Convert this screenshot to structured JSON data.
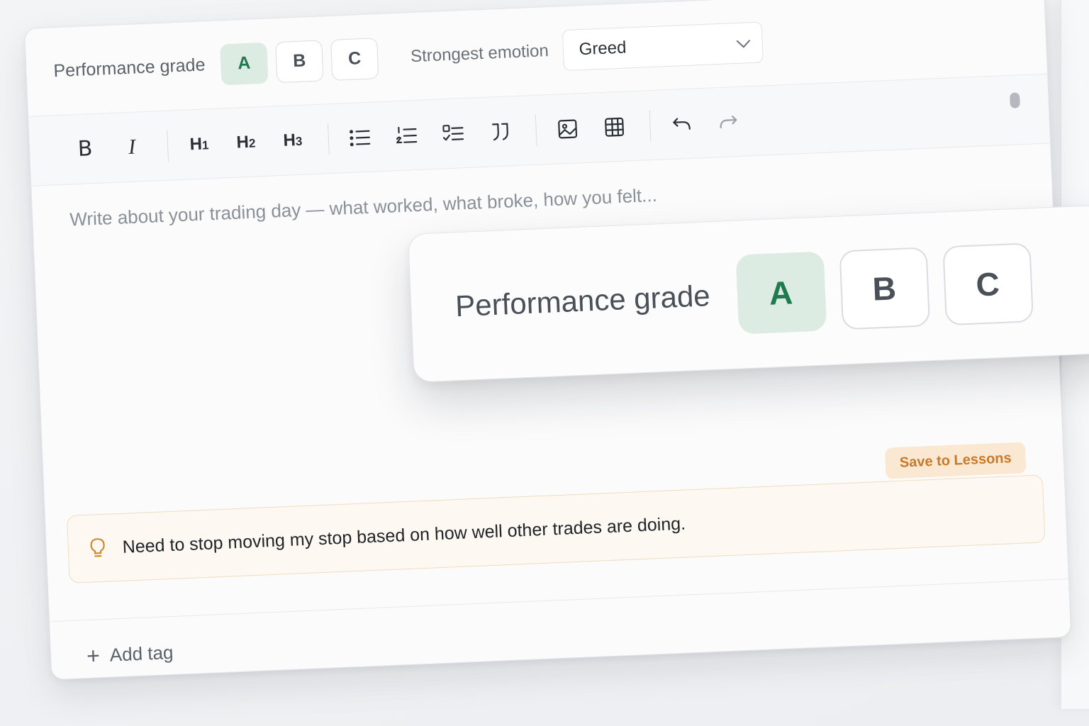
{
  "performance": {
    "label": "Performance grade",
    "grades": [
      "A",
      "B",
      "C"
    ],
    "selected": "A"
  },
  "emotion": {
    "label": "Strongest emotion",
    "value": "Greed"
  },
  "toolbar": {
    "bold": "B",
    "italic": "I",
    "h1": "H",
    "h1_sub": "1",
    "h2": "H",
    "h2_sub": "2",
    "h3": "H",
    "h3_sub": "3"
  },
  "editor": {
    "placeholder": "Write about your trading day — what worked, what broke, how you felt..."
  },
  "lesson": {
    "text": "Need to stop moving my stop based on how well other trades are doing.",
    "save_label": "Save to Lessons"
  },
  "footer": {
    "add_tag": "Add tag"
  },
  "colors": {
    "accent_green": "#1f7a4d",
    "accent_green_bg": "#dcece3",
    "lesson_orange": "#c67a2a",
    "lesson_bg": "#fdf8f1"
  }
}
